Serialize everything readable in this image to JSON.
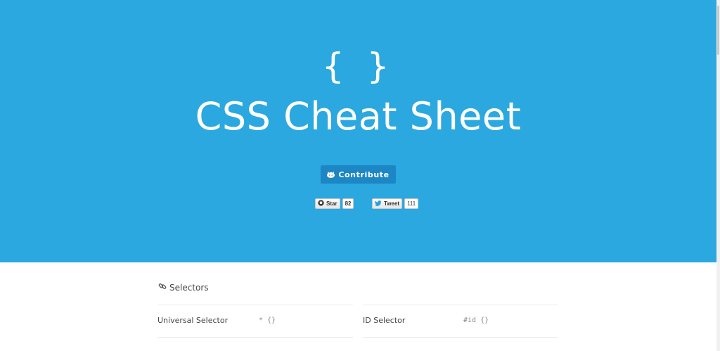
{
  "hero": {
    "logo": "{ }",
    "title": "CSS Cheat Sheet",
    "contribute_label": "Contribute",
    "star_label": "Star",
    "star_count": "82",
    "tweet_label": "Tweet",
    "tweet_count": "111",
    "background_color": "#2ba8e0",
    "button_color": "#1d86c4"
  },
  "selectors_section": {
    "title": "Selectors",
    "rows": [
      {
        "label": "Universal Selector",
        "code": "* {}"
      },
      {
        "label": "ID Selector",
        "code": "#id {}"
      }
    ]
  }
}
